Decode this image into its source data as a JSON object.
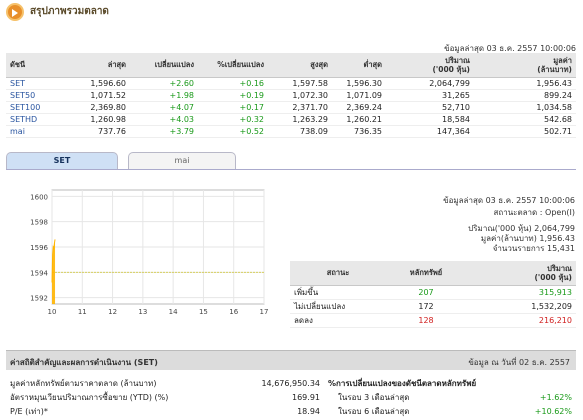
{
  "header": {
    "title": "สรุปภาพรวมตลาด"
  },
  "market": {
    "timestamp": "ข้อมูลล่าสุด 03 ธ.ค. 2557 10:00:06",
    "columns": [
      "ดัชนี",
      "ล่าสุด",
      "เปลี่ยนแปลง",
      "%เปลี่ยนแปลง",
      "สูงสุด",
      "ต่ำสุด",
      "ปริมาณ\n('000 หุ้น)",
      "มูลค่า\n(ล้านบาท)"
    ],
    "rows": [
      {
        "name": "SET",
        "last": "1,596.60",
        "chg": "+2.60",
        "pct": "+0.16",
        "high": "1,597.58",
        "low": "1,596.30",
        "vol": "2,064,799",
        "val": "1,956.43"
      },
      {
        "name": "SET50",
        "last": "1,071.52",
        "chg": "+1.98",
        "pct": "+0.19",
        "high": "1,072.30",
        "low": "1,071.09",
        "vol": "31,265",
        "val": "899.24"
      },
      {
        "name": "SET100",
        "last": "2,369.80",
        "chg": "+4.07",
        "pct": "+0.17",
        "high": "2,371.70",
        "low": "2,369.24",
        "vol": "52,710",
        "val": "1,034.58"
      },
      {
        "name": "SETHD",
        "last": "1,260.98",
        "chg": "+4.03",
        "pct": "+0.32",
        "high": "1,263.29",
        "low": "1,260.21",
        "vol": "18,584",
        "val": "542.68"
      },
      {
        "name": "mai",
        "last": "737.76",
        "chg": "+3.79",
        "pct": "+0.52",
        "high": "738.09",
        "low": "736.35",
        "vol": "147,364",
        "val": "502.71"
      }
    ]
  },
  "tabs": {
    "set": "SET",
    "mai": "mai"
  },
  "chart_data": {
    "type": "line",
    "x_ticks": [
      "10",
      "11",
      "12",
      "13",
      "14",
      "15",
      "16",
      "17"
    ],
    "y_ticks": [
      "1592",
      "1594",
      "1596",
      "1598",
      "1600"
    ],
    "ylim": [
      1591.5,
      1600.5
    ],
    "xlim": [
      10,
      17
    ],
    "x": [
      10.0,
      10.02,
      10.04,
      10.06,
      10.08,
      10.1
    ],
    "values": [
      1593.2,
      1595.4,
      1596.0,
      1595.9,
      1596.3,
      1596.6
    ],
    "reference": 1594.0,
    "colors": {
      "line": "#ffb400",
      "fill": "#ffb400",
      "reference": "#d8d060",
      "grid": "#e6e6e6"
    }
  },
  "summary": {
    "timestamp": "ข้อมูลล่าสุด 03 ธ.ค. 2557 10:00:06",
    "status_label": "สถานะตลาด :",
    "status_value": "Open(I)",
    "vol_label": "ปริมาณ('000 หุ้น)",
    "vol_value": "2,064,799",
    "val_label": "มูลค่า(ล้านบาท)",
    "val_value": "1,956.43",
    "trades_label": "จำนวนรายการ",
    "trades_value": "15,431"
  },
  "breadth": {
    "col_status": "สถานะ",
    "col_securities": "หลักทรัพย์",
    "col_volume": "ปริมาณ\n('000 หุ้น)",
    "rows": [
      {
        "label": "เพิ่มขึ้น",
        "count": "207",
        "vol": "315,913",
        "cls": "up"
      },
      {
        "label": "ไม่เปลี่ยนแปลง",
        "count": "172",
        "vol": "1,532,209",
        "cls": ""
      },
      {
        "label": "ลดลง",
        "count": "128",
        "vol": "216,210",
        "cls": "dn"
      }
    ]
  },
  "stats": {
    "title": "ค่าสถิติสำคัญและผลการดำเนินงาน (SET)",
    "date": "ข้อมูล ณ วันที่ 02 ธ.ค. 2557",
    "rows": [
      {
        "label": "มูลค่าหลักทรัพย์ตามราคาตลาด (ล้านบาท)",
        "value": "14,676,950.34"
      },
      {
        "label": "อัตราหมุนเวียนปริมาณการซื้อขาย (YTD) (%)",
        "value": "169.91"
      },
      {
        "label": "P/E (เท่า)*",
        "value": "18.94"
      }
    ],
    "pct_title": "%การเปลี่ยนแปลงของดัชนีตลาดหลักทรัพย์",
    "pct_rows": [
      {
        "label": "ในรอบ 3 เดือนล่าสุด",
        "value": "+1.62%"
      },
      {
        "label": "ในรอบ 6 เดือนล่าสุด",
        "value": "+10.62%"
      }
    ]
  }
}
